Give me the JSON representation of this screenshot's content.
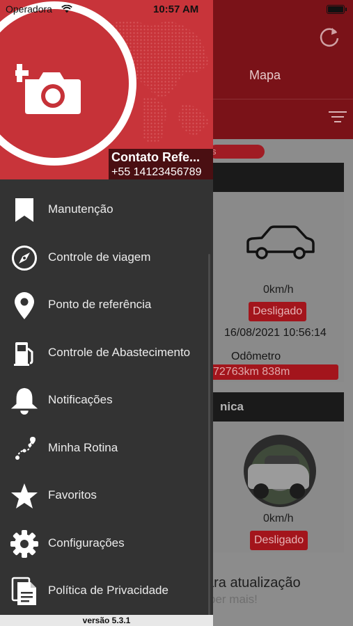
{
  "status_bar": {
    "carrier": "Operadora",
    "time": "10:57 AM"
  },
  "drawer": {
    "contact_name": "Contato Refe...",
    "contact_phone": "+55 14123456789",
    "menu": [
      {
        "label": "Manutenção",
        "icon": "bookmark-icon"
      },
      {
        "label": "Controle de viagem",
        "icon": "compass-icon"
      },
      {
        "label": "Ponto de referência",
        "icon": "map-pin-icon"
      },
      {
        "label": "Controle de Abastecimento",
        "icon": "fuel-pump-icon"
      },
      {
        "label": "Notificações",
        "icon": "bell-icon"
      },
      {
        "label": "Minha Rotina",
        "icon": "route-icon"
      },
      {
        "label": "Favoritos",
        "icon": "star-icon"
      },
      {
        "label": "Configurações",
        "icon": "gear-icon"
      },
      {
        "label": "Política de Privacidade",
        "icon": "document-icon"
      }
    ],
    "version": "versão  5.3.1"
  },
  "background": {
    "title_fragment": "s",
    "tab_map": "Mapa",
    "pill_fragment": "s",
    "card1": {
      "speed": "0km/h",
      "status": "Desligado",
      "datetime": "16/08/2021 10:56:14",
      "odometer_label": "Odômetro",
      "odometer_value": "72763km 838m"
    },
    "card2": {
      "title": "nica",
      "speed": "0km/h",
      "status": "Desligado"
    },
    "footer_line1": "ara atualização",
    "footer_line2": "ber mais!"
  },
  "colors": {
    "drawer_bg": "#333333",
    "header_red": "#c8343a",
    "status_red": "#a3151c"
  }
}
